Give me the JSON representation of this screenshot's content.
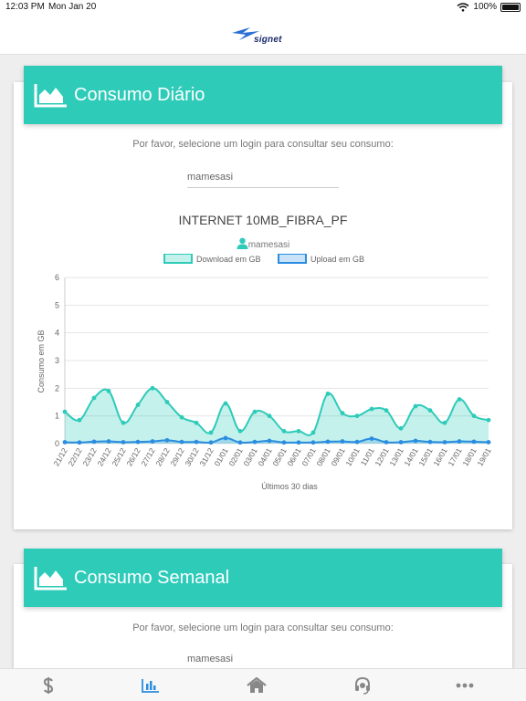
{
  "status_bar": {
    "time": "12:03 PM",
    "date": "Mon Jan 20",
    "battery": "100%",
    "battery_level": 1.0
  },
  "brand": {
    "logo_text": "signet",
    "accent": "#2ecbb9"
  },
  "daily": {
    "title": "Consumo Diário",
    "hint": "Por favor, selecione um login para consultar seu consumo:",
    "login_value": "mamesasi",
    "plan_name": "INTERNET 10MB_FIBRA_PF",
    "user": "mamesasi"
  },
  "weekly": {
    "title": "Consumo Semanal",
    "hint": "Por favor, selecione um login para consultar seu consumo:",
    "login_value": "mamesasi"
  },
  "tabs": [
    {
      "name": "billing",
      "icon": "dollar-icon",
      "active": false
    },
    {
      "name": "consumption",
      "icon": "bar-chart-icon",
      "active": true
    },
    {
      "name": "home",
      "icon": "home-icon",
      "active": false
    },
    {
      "name": "support",
      "icon": "headset-icon",
      "active": false
    },
    {
      "name": "more",
      "icon": "more-icon",
      "active": false
    }
  ],
  "chart_data": {
    "type": "area",
    "xlabel": "Últimos 30 dias",
    "ylabel": "Consumo em GB",
    "ylim": [
      0,
      6
    ],
    "yticks": [
      0,
      1,
      2,
      3,
      4,
      5,
      6
    ],
    "grid": true,
    "legend_position": "top",
    "categories": [
      "21/12",
      "22/12",
      "23/12",
      "24/12",
      "25/12",
      "26/12",
      "27/12",
      "28/12",
      "29/12",
      "30/12",
      "31/12",
      "01/01",
      "02/01",
      "03/01",
      "04/01",
      "05/01",
      "06/01",
      "07/01",
      "08/01",
      "09/01",
      "10/01",
      "11/01",
      "12/01",
      "13/01",
      "14/01",
      "15/01",
      "16/01",
      "17/01",
      "18/01",
      "19/01"
    ],
    "series": [
      {
        "name": "Download em GB",
        "color": "#2ecbb9",
        "values": [
          1.15,
          0.85,
          1.65,
          1.9,
          0.75,
          1.4,
          2.0,
          1.5,
          0.95,
          0.75,
          0.4,
          1.45,
          0.45,
          1.15,
          1.0,
          0.45,
          0.45,
          0.4,
          1.8,
          1.1,
          1.0,
          1.25,
          1.2,
          0.55,
          1.35,
          1.2,
          0.75,
          1.6,
          1.0,
          0.85
        ]
      },
      {
        "name": "Upload em GB",
        "color": "#2a8de0",
        "values": [
          0.05,
          0.04,
          0.07,
          0.08,
          0.05,
          0.06,
          0.08,
          0.12,
          0.06,
          0.06,
          0.04,
          0.2,
          0.04,
          0.06,
          0.1,
          0.04,
          0.04,
          0.04,
          0.07,
          0.08,
          0.06,
          0.18,
          0.05,
          0.05,
          0.1,
          0.06,
          0.05,
          0.08,
          0.07,
          0.05
        ]
      }
    ]
  }
}
